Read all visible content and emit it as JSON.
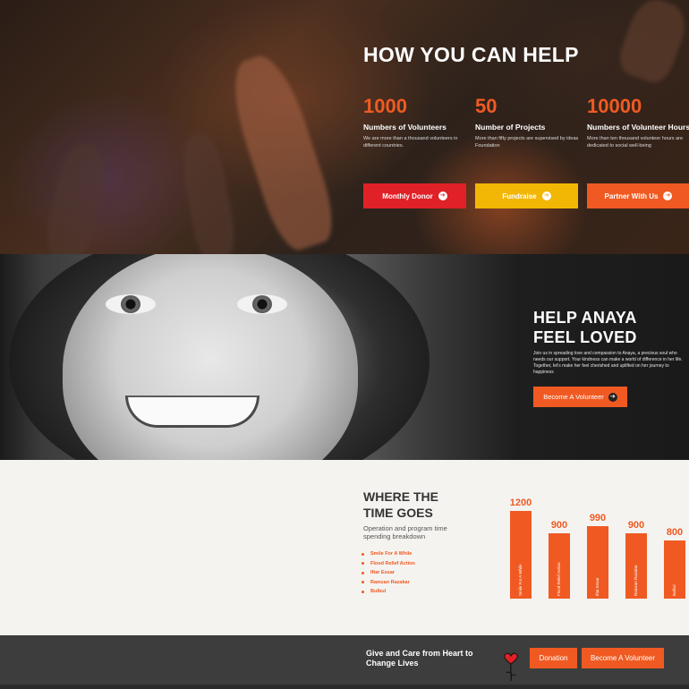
{
  "hero": {
    "title": "HOW YOU CAN HELP",
    "stats": [
      {
        "value": "1000",
        "label": "Numbers of Volunteers",
        "desc": "We are more than a thousand volunteers in different countries."
      },
      {
        "value": "50",
        "label": "Number of Projects",
        "desc": "More than fifty projects are supervised by ideas Foundation"
      },
      {
        "value": "10000",
        "label": "Numbers of Volunteer Hours",
        "desc": "More than ten thousand volunteer hours are dedicated to social well-being"
      }
    ],
    "buttons": [
      {
        "label": "Monthly Donor",
        "color": "#e02127"
      },
      {
        "label": "Fundraise",
        "color": "#f2b705"
      },
      {
        "label": "Partner With Us",
        "color": "#f05a22"
      }
    ]
  },
  "girl": {
    "title_line1": "HELP ANAYA",
    "title_line2": "FEEL LOVED",
    "text": "Join us in spreading love and compassion to Anaya, a precious soul who needs our support. Your kindness can make a world of difference in her life. Together, let's make her feel cherished and uplifted on her journey to happiness",
    "button_label": "Become A Volunteer"
  },
  "time": {
    "title_line1": "WHERE THE",
    "title_line2": "TIME GOES",
    "subtitle": "Operation and program time spending breakdown",
    "legend": [
      "Smile For A While",
      "Flood Relief Action",
      "Iftar Essar",
      "Ramzan Razakar",
      "Bulbul"
    ]
  },
  "chart_data": {
    "type": "bar",
    "categories": [
      "Smile For A While",
      "Flood Relief Action",
      "Iftar Essar",
      "Ramzan Razakar",
      "Bulbul"
    ],
    "values": [
      1200,
      900,
      990,
      900,
      800
    ],
    "data_labels": [
      "1200",
      "900",
      "990",
      "900",
      "800"
    ],
    "color": "#f05a22"
  },
  "cta": {
    "text": "Give and Care from Heart to Change Lives",
    "donation_label": "Donation",
    "volunteer_label": "Become A Volunteer"
  },
  "icons": {
    "arrow": "➔",
    "heart": "heart-icon"
  },
  "colors": {
    "accent": "#f05a22",
    "red": "#e02127",
    "yellow": "#f2b705"
  }
}
